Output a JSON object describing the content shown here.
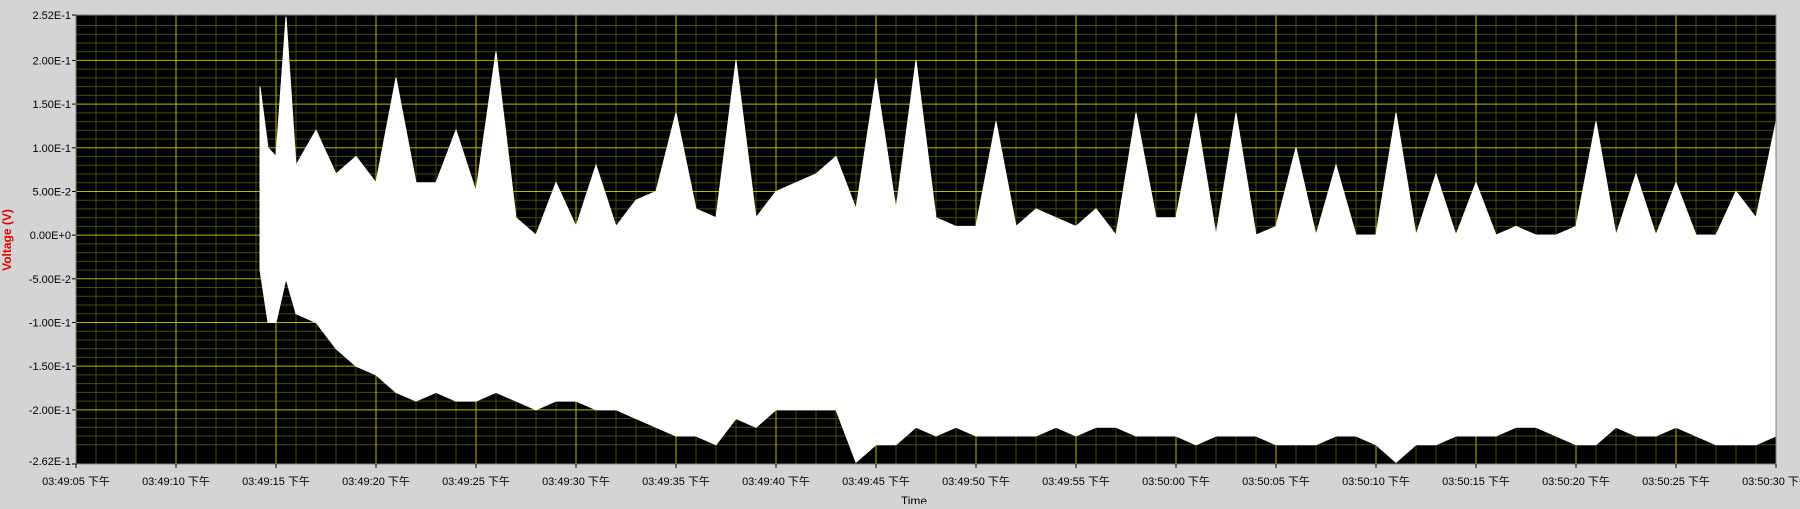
{
  "chart_data": {
    "type": "line",
    "title": "",
    "xlabel": "Time",
    "ylabel": "Voltage (V)",
    "ylim": [
      -0.262,
      0.252
    ],
    "xlim": [
      "03:49:05 下午",
      "03:50:30 下午"
    ],
    "grid": true,
    "legend": "none",
    "y_ticks": [
      "2.52E-1",
      "2.00E-1",
      "1.50E-1",
      "1.00E-1",
      "5.00E-2",
      "0.00E+0",
      "-5.00E-2",
      "-1.00E-1",
      "-1.50E-1",
      "-2.00E-1",
      "-2.62E-1"
    ],
    "y_tick_values": [
      0.252,
      0.2,
      0.15,
      0.1,
      0.05,
      0,
      -0.05,
      -0.1,
      -0.15,
      -0.2,
      -0.262
    ],
    "x_ticks": [
      "03:49:05 下午",
      "03:49:10 下午",
      "03:49:15 下午",
      "03:49:20 下午",
      "03:49:25 下午",
      "03:49:30 下午",
      "03:49:35 下午",
      "03:49:40 下午",
      "03:49:45 下午",
      "03:49:50 下午",
      "03:49:55 下午",
      "03:50:00 下午",
      "03:50:05 下午",
      "03:50:10 下午",
      "03:50:15 下午",
      "03:50:20 下午",
      "03:50:25 下午",
      "03:50:30 下午"
    ],
    "series": [
      {
        "color": "#ffffff",
        "x": [
          "03:49:14.2",
          "03:49:14.6",
          "03:49:15.0",
          "03:49:15.5",
          "03:49:16.0",
          "03:49:17.0",
          "03:49:18.0",
          "03:49:19.0",
          "03:49:20.0",
          "03:49:21.0",
          "03:49:22.0",
          "03:49:23.0",
          "03:49:24.0",
          "03:49:25.0",
          "03:49:26.0",
          "03:49:27.0",
          "03:49:28.0",
          "03:49:29.0",
          "03:49:30.0",
          "03:49:31.0",
          "03:49:32.0",
          "03:49:33.0",
          "03:49:34.0",
          "03:49:35.0",
          "03:49:36.0",
          "03:49:37.0",
          "03:49:38.0",
          "03:49:39.0",
          "03:49:40.0",
          "03:49:41.0",
          "03:49:42.0",
          "03:49:43.0",
          "03:49:44.0",
          "03:49:45.0",
          "03:49:46.0",
          "03:49:47.0",
          "03:49:48.0",
          "03:49:49.0",
          "03:49:50.0",
          "03:49:51.0",
          "03:49:52.0",
          "03:49:53.0",
          "03:49:54.0",
          "03:49:55.0",
          "03:49:56.0",
          "03:49:57.0",
          "03:49:58.0",
          "03:49:59.0",
          "03:50:00.0",
          "03:50:01.0",
          "03:50:02.0",
          "03:50:03.0",
          "03:50:04.0",
          "03:50:05.0",
          "03:50:06.0",
          "03:50:07.0",
          "03:50:08.0",
          "03:50:09.0",
          "03:50:10.0",
          "03:50:11.0",
          "03:50:12.0",
          "03:50:13.0",
          "03:50:14.0",
          "03:50:15.0",
          "03:50:16.0",
          "03:50:17.0",
          "03:50:18.0",
          "03:50:19.0",
          "03:50:20.0",
          "03:50:21.0",
          "03:50:22.0",
          "03:50:23.0",
          "03:50:24.0",
          "03:50:25.0",
          "03:50:26.0",
          "03:50:27.0",
          "03:50:28.0",
          "03:50:29.0",
          "03:50:30.0"
        ],
        "max": [
          0.17,
          0.1,
          0.09,
          0.25,
          0.08,
          0.12,
          0.07,
          0.09,
          0.06,
          0.18,
          0.06,
          0.06,
          0.12,
          0.05,
          0.21,
          0.02,
          0.0,
          0.06,
          0.01,
          0.08,
          0.01,
          0.04,
          0.05,
          0.14,
          0.03,
          0.02,
          0.2,
          0.02,
          0.05,
          0.06,
          0.07,
          0.09,
          0.03,
          0.18,
          0.03,
          0.2,
          0.02,
          0.01,
          0.01,
          0.13,
          0.01,
          0.03,
          0.02,
          0.01,
          0.03,
          0.0,
          0.14,
          0.02,
          0.02,
          0.14,
          0.0,
          0.14,
          0.0,
          0.01,
          0.1,
          0.0,
          0.08,
          0.0,
          0.0,
          0.14,
          0.0,
          0.07,
          0.0,
          0.06,
          0.0,
          0.01,
          0.0,
          0.0,
          0.01,
          0.13,
          0.0,
          0.07,
          0.0,
          0.06,
          0.0,
          0.0,
          0.05,
          0.02,
          0.13
        ],
        "min": [
          -0.04,
          -0.1,
          -0.1,
          -0.05,
          -0.09,
          -0.1,
          -0.13,
          -0.15,
          -0.16,
          -0.18,
          -0.19,
          -0.18,
          -0.19,
          -0.19,
          -0.18,
          -0.19,
          -0.2,
          -0.19,
          -0.19,
          -0.2,
          -0.2,
          -0.21,
          -0.22,
          -0.23,
          -0.23,
          -0.24,
          -0.21,
          -0.22,
          -0.2,
          -0.2,
          -0.2,
          -0.2,
          -0.26,
          -0.24,
          -0.24,
          -0.22,
          -0.23,
          -0.22,
          -0.23,
          -0.23,
          -0.23,
          -0.23,
          -0.22,
          -0.23,
          -0.22,
          -0.22,
          -0.23,
          -0.23,
          -0.23,
          -0.24,
          -0.23,
          -0.23,
          -0.23,
          -0.24,
          -0.24,
          -0.24,
          -0.23,
          -0.23,
          -0.24,
          -0.26,
          -0.24,
          -0.24,
          -0.23,
          -0.23,
          -0.23,
          -0.22,
          -0.22,
          -0.23,
          -0.24,
          -0.24,
          -0.22,
          -0.23,
          -0.23,
          -0.22,
          -0.23,
          -0.24,
          -0.24,
          -0.24,
          -0.23
        ]
      }
    ]
  }
}
